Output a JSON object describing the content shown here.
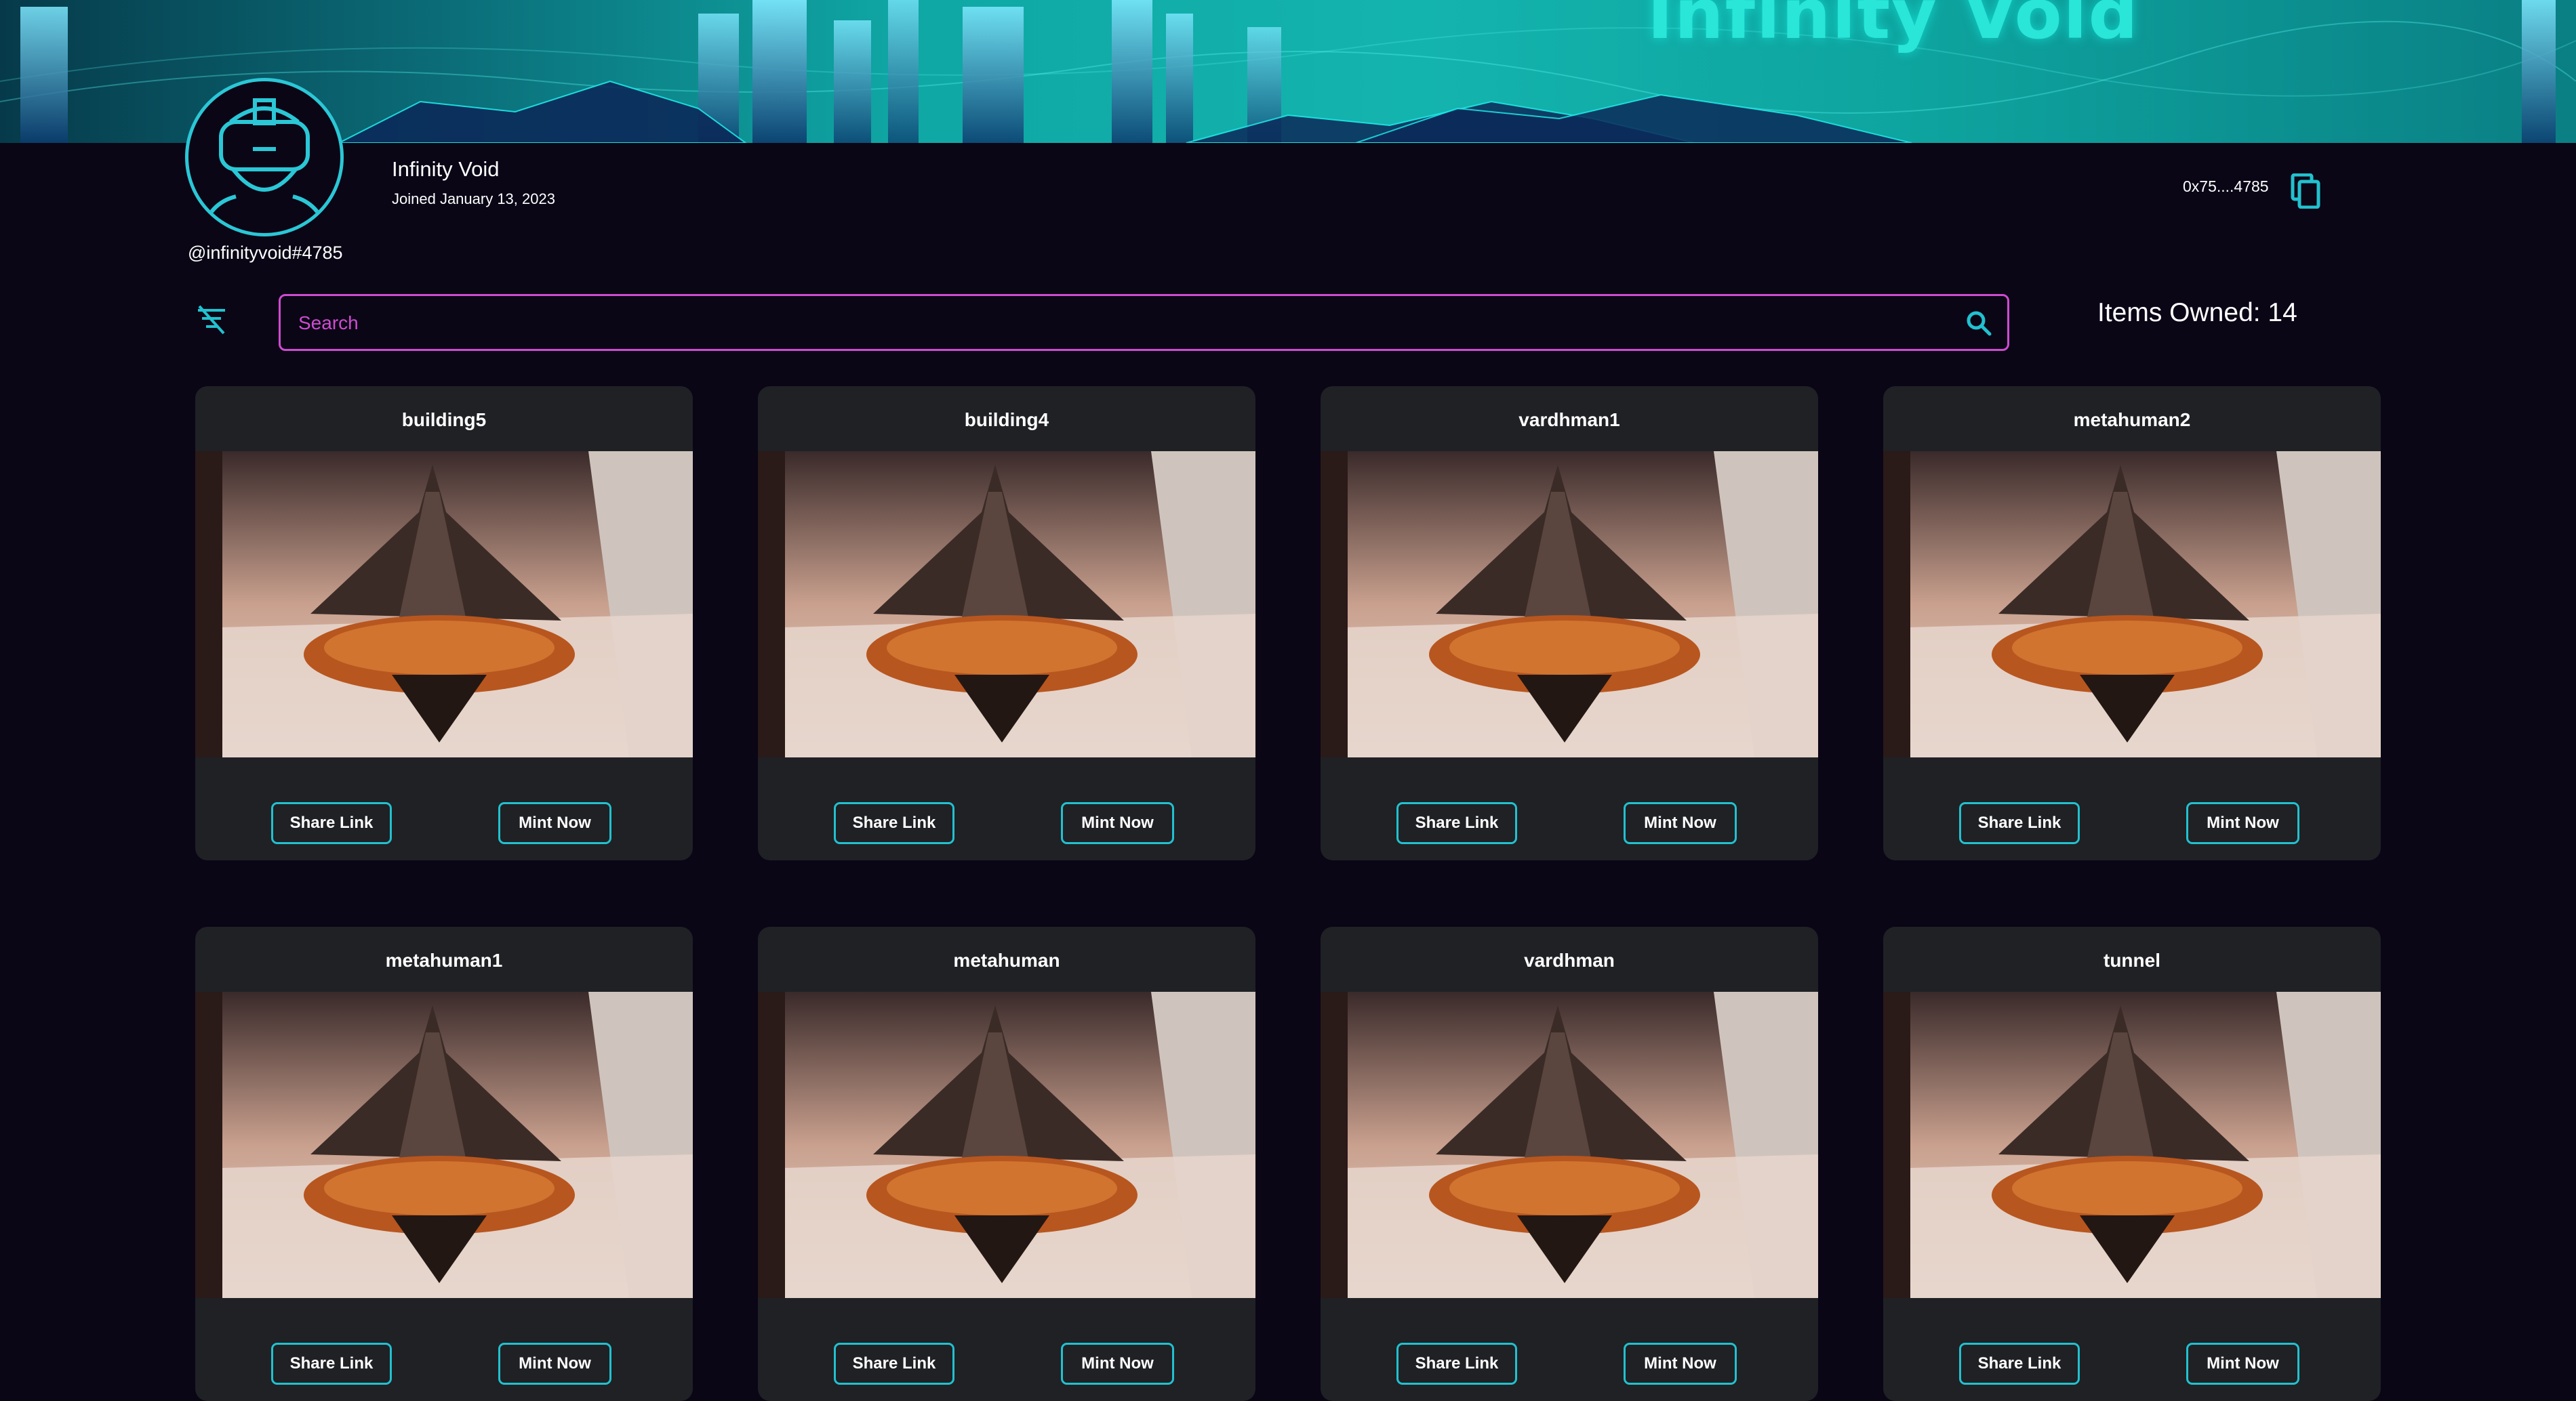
{
  "banner": {
    "title": "Infinity Void"
  },
  "profile": {
    "name": "Infinity Void",
    "joined": "Joined January 13, 2023",
    "handle": "@infinityvoid#4785",
    "wallet": "0x75....4785"
  },
  "search": {
    "placeholder": "Search"
  },
  "items_owned": "Items Owned: 14",
  "cards": [
    {
      "title": "building5",
      "share_label": "Share Link",
      "mint_label": "Mint Now"
    },
    {
      "title": "building4",
      "share_label": "Share Link",
      "mint_label": "Mint Now"
    },
    {
      "title": "vardhman1",
      "share_label": "Share Link",
      "mint_label": "Mint Now"
    },
    {
      "title": "metahuman2",
      "share_label": "Share Link",
      "mint_label": "Mint Now"
    },
    {
      "title": "metahuman1",
      "share_label": "Share Link",
      "mint_label": "Mint Now"
    },
    {
      "title": "metahuman",
      "share_label": "Share Link",
      "mint_label": "Mint Now"
    },
    {
      "title": "vardhman",
      "share_label": "Share Link",
      "mint_label": "Mint Now"
    },
    {
      "title": "tunnel",
      "share_label": "Share Link",
      "mint_label": "Mint Now"
    }
  ],
  "icons": {
    "avatar": "vr-headset-user-icon",
    "copy": "copy-icon",
    "filter": "filter-off-icon",
    "search": "search-icon"
  },
  "colors": {
    "background": "#0a0616",
    "accent_cyan": "#22c1cf",
    "search_border": "#d04bd1",
    "card_background": "#1f2125"
  }
}
